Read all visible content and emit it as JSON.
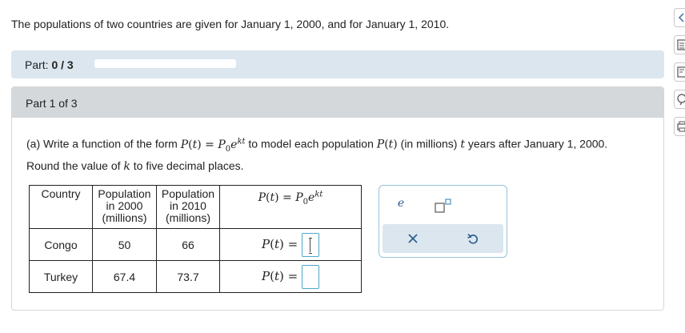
{
  "intro": "The populations of two countries are given for January 1, 2000, and for January 1, 2010.",
  "part_bar": {
    "label_prefix": "Part:",
    "label_value": "0 / 3",
    "progress_fraction": 0.0
  },
  "part_header": "Part 1 of 3",
  "question": {
    "line1_a": "(a) Write a function of the form",
    "line1_b": "to model each population",
    "line1_c": "(in millions)",
    "line1_d": "years after January 1, 2000.",
    "line2_a": "Round the value of",
    "line2_b": "to five decimal places."
  },
  "table": {
    "headers": {
      "country": "Country",
      "pop2000": [
        "Population",
        "in 2000",
        "(millions)"
      ],
      "pop2010": [
        "Population",
        "in 2010",
        "(millions)"
      ]
    },
    "rows": [
      {
        "country": "Congo",
        "pop2000": "50",
        "pop2010": "66"
      },
      {
        "country": "Turkey",
        "pop2000": "67.4",
        "pop2010": "73.7"
      }
    ]
  },
  "keypad": {
    "e_label": "e"
  },
  "side_tools": [
    "collapse-icon",
    "calculator-icon",
    "notes-icon",
    "help-icon",
    "print-icon"
  ]
}
